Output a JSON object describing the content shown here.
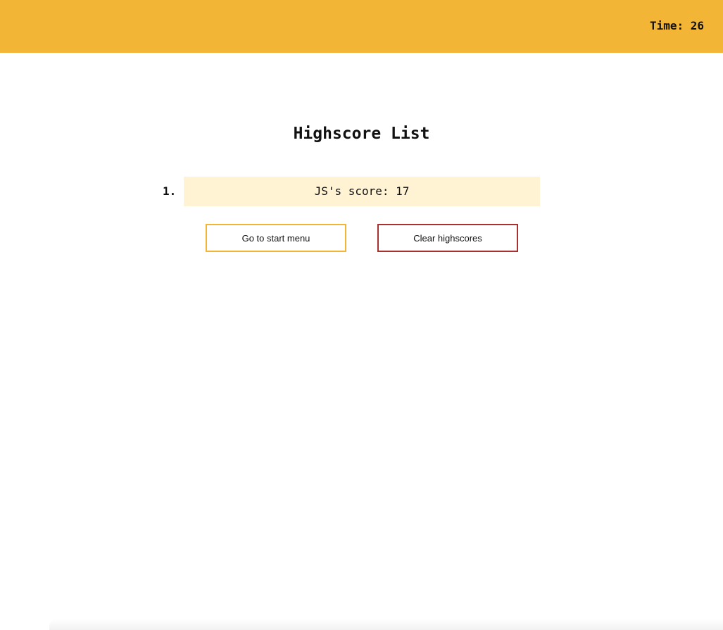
{
  "header": {
    "timer_text": "Time: 26"
  },
  "main": {
    "title": "Highscore List",
    "scores": [
      {
        "rank": "1.",
        "text": "JS's score: 17"
      }
    ],
    "buttons": {
      "start_menu_label": "Go to start menu",
      "clear_label": "Clear highscores"
    }
  },
  "colors": {
    "header_bg": "#f2b535",
    "score_bg": "#fff3d4",
    "start_button_border": "#f2b535",
    "clear_button_border": "#a8302f"
  }
}
